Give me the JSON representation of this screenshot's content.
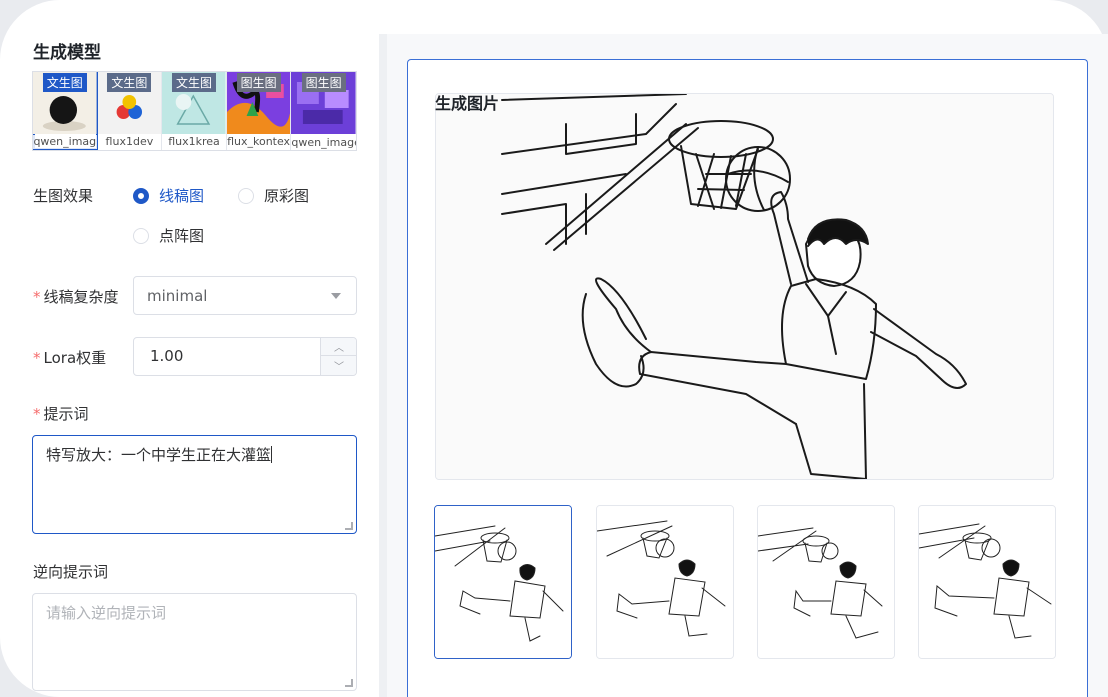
{
  "left_panel": {
    "model_section_title": "生成模型",
    "models": [
      {
        "tag": "文生图",
        "name": "qwen_imag",
        "selected": true
      },
      {
        "tag": "文生图",
        "name": "flux1dev",
        "selected": false
      },
      {
        "tag": "文生图",
        "name": "flux1krea",
        "selected": false
      },
      {
        "tag": "图生图",
        "name": "flux_kontex",
        "selected": false
      },
      {
        "tag": "图生图",
        "name": "qwen_image_edit",
        "selected": false
      }
    ],
    "effect": {
      "label": "生图效果",
      "options": [
        "线稿图",
        "原彩图",
        "点阵图"
      ],
      "selected": "线稿图"
    },
    "complexity": {
      "required_mark": "*",
      "label": "线稿复杂度",
      "value": "minimal"
    },
    "lora": {
      "required_mark": "*",
      "label": "Lora权重",
      "value": "1.00"
    },
    "prompt": {
      "required_mark": "*",
      "label": "提示词",
      "value": "特写放大：一个中学生正在大灌篮"
    },
    "negative_prompt": {
      "label": "逆向提示词",
      "placeholder": "请输入逆向提示词"
    }
  },
  "right_panel": {
    "title": "生成图片",
    "thumbnails_count": 4,
    "selected_thumbnail": 0
  },
  "colors": {
    "accent": "#1f58c7",
    "required": "#f56c6c",
    "border": "#dcdfe6"
  }
}
